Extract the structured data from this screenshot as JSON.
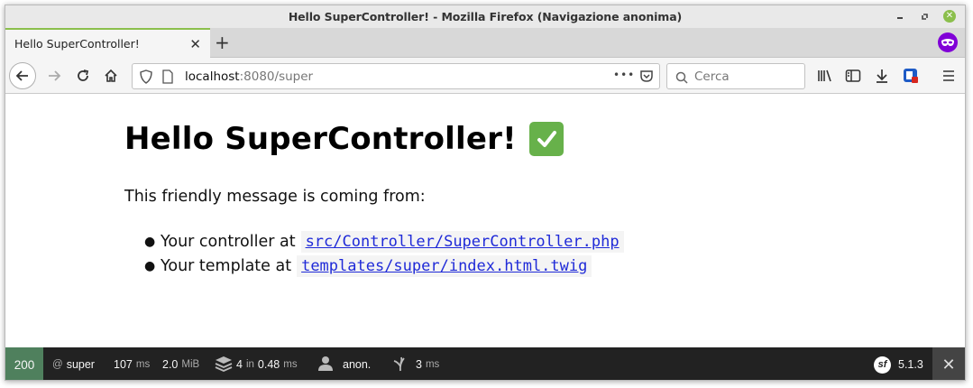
{
  "window": {
    "title": "Hello SuperController! - Mozilla Firefox (Navigazione anonima)"
  },
  "tab": {
    "title": "Hello SuperController!",
    "close_label": "✕",
    "new_tab_label": "+"
  },
  "navbar": {
    "url_host": "localhost",
    "url_rest": ":8080/super",
    "page_actions_label": "•••",
    "search_placeholder": "Cerca"
  },
  "page": {
    "heading": "Hello SuperController!",
    "intro": "This friendly message is coming from:",
    "items": [
      {
        "label": "Your controller at",
        "code": "src/Controller/SuperController.php"
      },
      {
        "label": "Your template at",
        "code": "templates/super/index.html.twig"
      }
    ]
  },
  "toolbar": {
    "status": "200",
    "route_at": "@",
    "route": "super",
    "time_value": "107",
    "time_unit": "ms",
    "memory_value": "2.0",
    "memory_unit": "MiB",
    "cache_count": "4",
    "cache_in": "in",
    "cache_time": "0.48",
    "cache_unit": "ms",
    "user": "anon.",
    "twig_time": "3",
    "twig_unit": "ms",
    "version": "5.1.3",
    "close_label": "✕",
    "logo_text": "sf"
  },
  "colors": {
    "status_ok": "#4f805d",
    "tab_accent": "#8bbf4c",
    "private_purple": "#8000d7",
    "link_blue": "#1f2ad8",
    "check_green": "#67b14a"
  },
  "icons": [
    "minimize-icon",
    "maximize-icon",
    "close-icon",
    "private-browsing-icon",
    "back-icon",
    "forward-icon",
    "reload-icon",
    "home-icon",
    "shield-icon",
    "page-icon",
    "pocket-icon",
    "search-icon",
    "library-icon",
    "sidebar-icon",
    "download-icon",
    "extension-icon",
    "menu-icon",
    "check-mark-icon",
    "layers-icon",
    "user-icon",
    "twig-icon",
    "symfony-icon"
  ]
}
